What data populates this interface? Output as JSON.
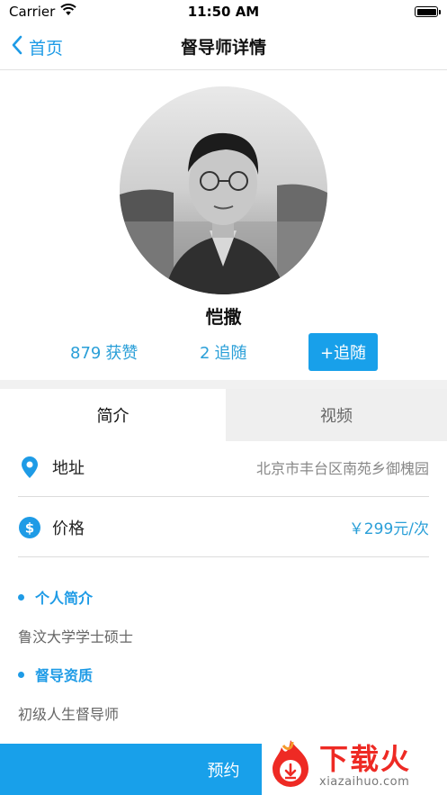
{
  "status_bar": {
    "carrier": "Carrier",
    "time": "11:50 AM"
  },
  "nav": {
    "back_label": "首页",
    "title": "督导师详情"
  },
  "profile": {
    "name": "恺撒",
    "likes_count": "879",
    "likes_label": "获赞",
    "followers_count": "2",
    "followers_label": "追随",
    "follow_button": "+追随"
  },
  "tabs": [
    {
      "label": "简介",
      "active": true
    },
    {
      "label": "视频",
      "active": false
    }
  ],
  "info": {
    "address_label": "地址",
    "address_value": "北京市丰台区南苑乡御槐园",
    "price_label": "价格",
    "price_value": "￥299元/次"
  },
  "sections": [
    {
      "title": "个人简介",
      "body": "鲁汶大学学士硕士"
    },
    {
      "title": "督导资质",
      "body": "初级人生督导师"
    }
  ],
  "bottom": {
    "book_label": "预约"
  },
  "watermark": {
    "main": "下载火",
    "sub": "xiazaihuo.com"
  },
  "colors": {
    "accent": "#1e9be6",
    "button": "#18a0ea",
    "watermark_red": "#ee2a24"
  }
}
